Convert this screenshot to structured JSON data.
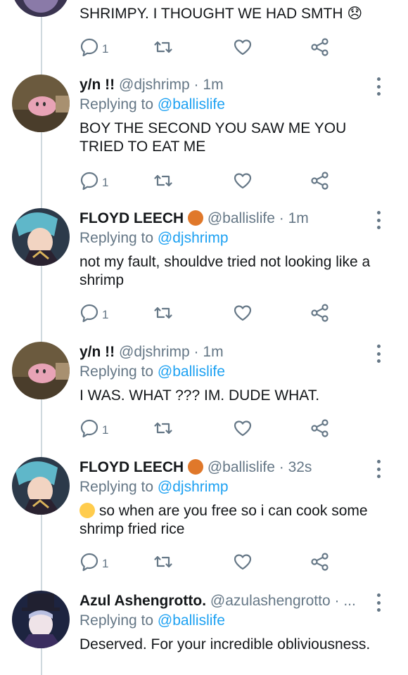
{
  "top_tweet": {
    "text": "SHRIMPY. I THOUGHT WE HAD SMTH 😞",
    "reply_count": "1"
  },
  "tweets": [
    {
      "name": "y/n !!",
      "handle": "@djshrimp",
      "time": "1m",
      "replying_label": "Replying to",
      "replying_to": "@ballislife",
      "text": "BOY THE SECOND YOU SAW ME YOU TRIED TO EAT ME",
      "reply_count": "1"
    },
    {
      "name": "FLOYD LEECH",
      "handle": "@ballislife",
      "time": "1m",
      "replying_label": "Replying to",
      "replying_to": "@djshrimp",
      "text": "not my fault, shouldve tried not looking like a shrimp",
      "reply_count": "1"
    },
    {
      "name": "y/n !!",
      "handle": "@djshrimp",
      "time": "1m",
      "replying_label": "Replying to",
      "replying_to": "@ballislife",
      "text": "I WAS. WHAT ??? IM. DUDE WHAT.",
      "reply_count": "1"
    },
    {
      "name": "FLOYD LEECH",
      "handle": "@ballislife",
      "time": "32s",
      "replying_label": "Replying to",
      "replying_to": "@djshrimp",
      "text": "so when are you free so i can cook some shrimp fried rice",
      "reply_count": "1"
    },
    {
      "name": "Azul Ashengrotto.",
      "handle": "@azulashengrotto",
      "time": "...",
      "replying_label": "Replying to",
      "replying_to": "@ballislife",
      "text": "Deserved. For your incredible obliviousness."
    }
  ],
  "separator": "·",
  "icons": {
    "reply": "reply-icon",
    "retweet": "retweet-icon",
    "like": "heart-icon",
    "share": "share-icon",
    "more": "more-vertical-icon"
  },
  "colors": {
    "link": "#1da1f2",
    "secondary": "#657786",
    "text": "#14171a"
  }
}
